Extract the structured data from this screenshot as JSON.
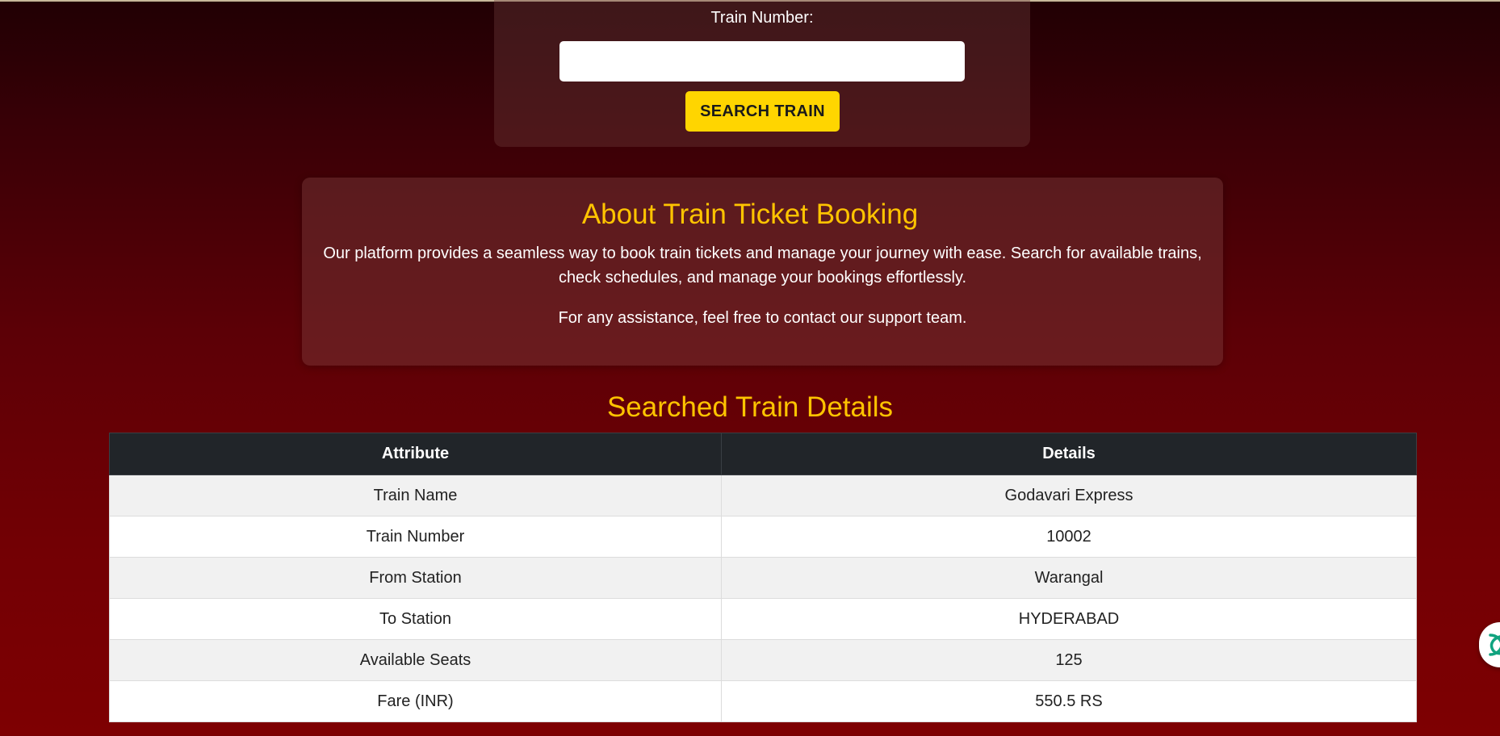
{
  "search": {
    "label": "Train Number:",
    "input_value": "",
    "button_label": "SEARCH TRAIN"
  },
  "about": {
    "title": "About Train Ticket Booking",
    "paragraph_1": "Our platform provides a seamless way to book train tickets and manage your journey with ease. Search for available trains, check schedules, and manage your bookings effortlessly.",
    "paragraph_2": "For any assistance, feel free to contact our support team."
  },
  "details": {
    "title": "Searched Train Details",
    "headers": [
      "Attribute",
      "Details"
    ],
    "rows": [
      {
        "attribute": "Train Name",
        "value": "Godavari Express"
      },
      {
        "attribute": "Train Number",
        "value": "10002"
      },
      {
        "attribute": "From Station",
        "value": "Warangal"
      },
      {
        "attribute": "To Station",
        "value": "HYDERABAD"
      },
      {
        "attribute": "Available Seats",
        "value": "125"
      },
      {
        "attribute": "Fare (INR)",
        "value": "550.5 RS"
      }
    ]
  },
  "chat_widget": {
    "icon": "chat-assistant-icon",
    "color": "#10a37f"
  },
  "colors": {
    "accent_yellow": "#ffc400",
    "button_yellow": "#ffd500",
    "table_header": "#212529"
  }
}
